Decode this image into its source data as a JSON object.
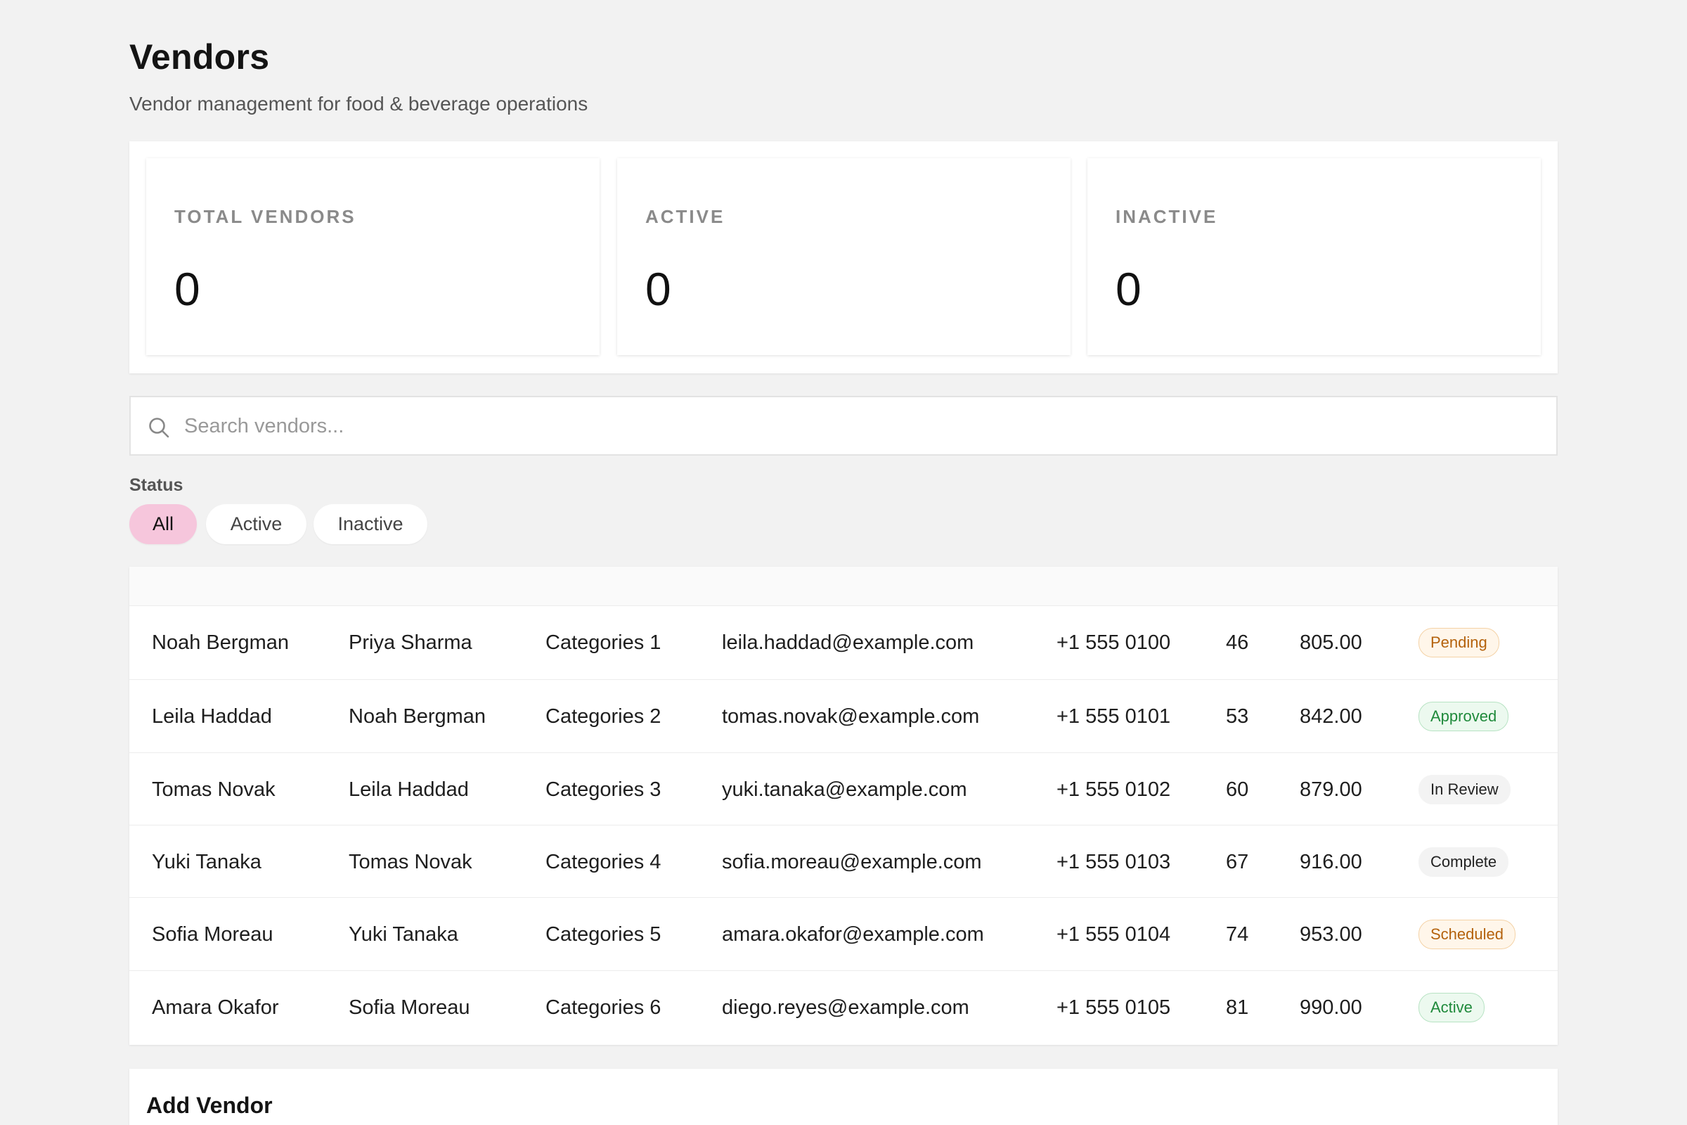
{
  "header": {
    "title": "Vendors",
    "subtitle": "Vendor management for food & beverage operations"
  },
  "stats": [
    {
      "label": "TOTAL VENDORS",
      "value": "0"
    },
    {
      "label": "ACTIVE",
      "value": "0"
    },
    {
      "label": "INACTIVE",
      "value": "0"
    }
  ],
  "search": {
    "placeholder": "Search vendors...",
    "value": ""
  },
  "filter": {
    "label": "Status",
    "options": [
      "All",
      "Active",
      "Inactive"
    ],
    "selected": "All"
  },
  "table": {
    "rows": [
      {
        "name": "Noah Bergman",
        "contact": "Priya Sharma",
        "category": "Categories 1",
        "email": "leila.haddad@example.com",
        "phone": "+1 555 0100",
        "count": "46",
        "amount": "805.00",
        "status": "Pending"
      },
      {
        "name": "Leila Haddad",
        "contact": "Noah Bergman",
        "category": "Categories 2",
        "email": "tomas.novak@example.com",
        "phone": "+1 555 0101",
        "count": "53",
        "amount": "842.00",
        "status": "Approved"
      },
      {
        "name": "Tomas Novak",
        "contact": "Leila Haddad",
        "category": "Categories 3",
        "email": "yuki.tanaka@example.com",
        "phone": "+1 555 0102",
        "count": "60",
        "amount": "879.00",
        "status": "In Review"
      },
      {
        "name": "Yuki Tanaka",
        "contact": "Tomas Novak",
        "category": "Categories 4",
        "email": "sofia.moreau@example.com",
        "phone": "+1 555 0103",
        "count": "67",
        "amount": "916.00",
        "status": "Complete"
      },
      {
        "name": "Sofia Moreau",
        "contact": "Yuki Tanaka",
        "category": "Categories 5",
        "email": "amara.okafor@example.com",
        "phone": "+1 555 0104",
        "count": "74",
        "amount": "953.00",
        "status": "Scheduled"
      },
      {
        "name": "Amara Okafor",
        "contact": "Sofia Moreau",
        "category": "Categories 6",
        "email": "diego.reyes@example.com",
        "phone": "+1 555 0105",
        "count": "81",
        "amount": "990.00",
        "status": "Active"
      }
    ]
  },
  "add_form": {
    "title": "Add Vendor"
  },
  "colors": {
    "accent_pill": "#f6c6dc",
    "background": "#f2f2f2",
    "status_pending": "#b4620d",
    "status_approved": "#1f8a3b"
  },
  "icons": {
    "search": "search-icon"
  }
}
